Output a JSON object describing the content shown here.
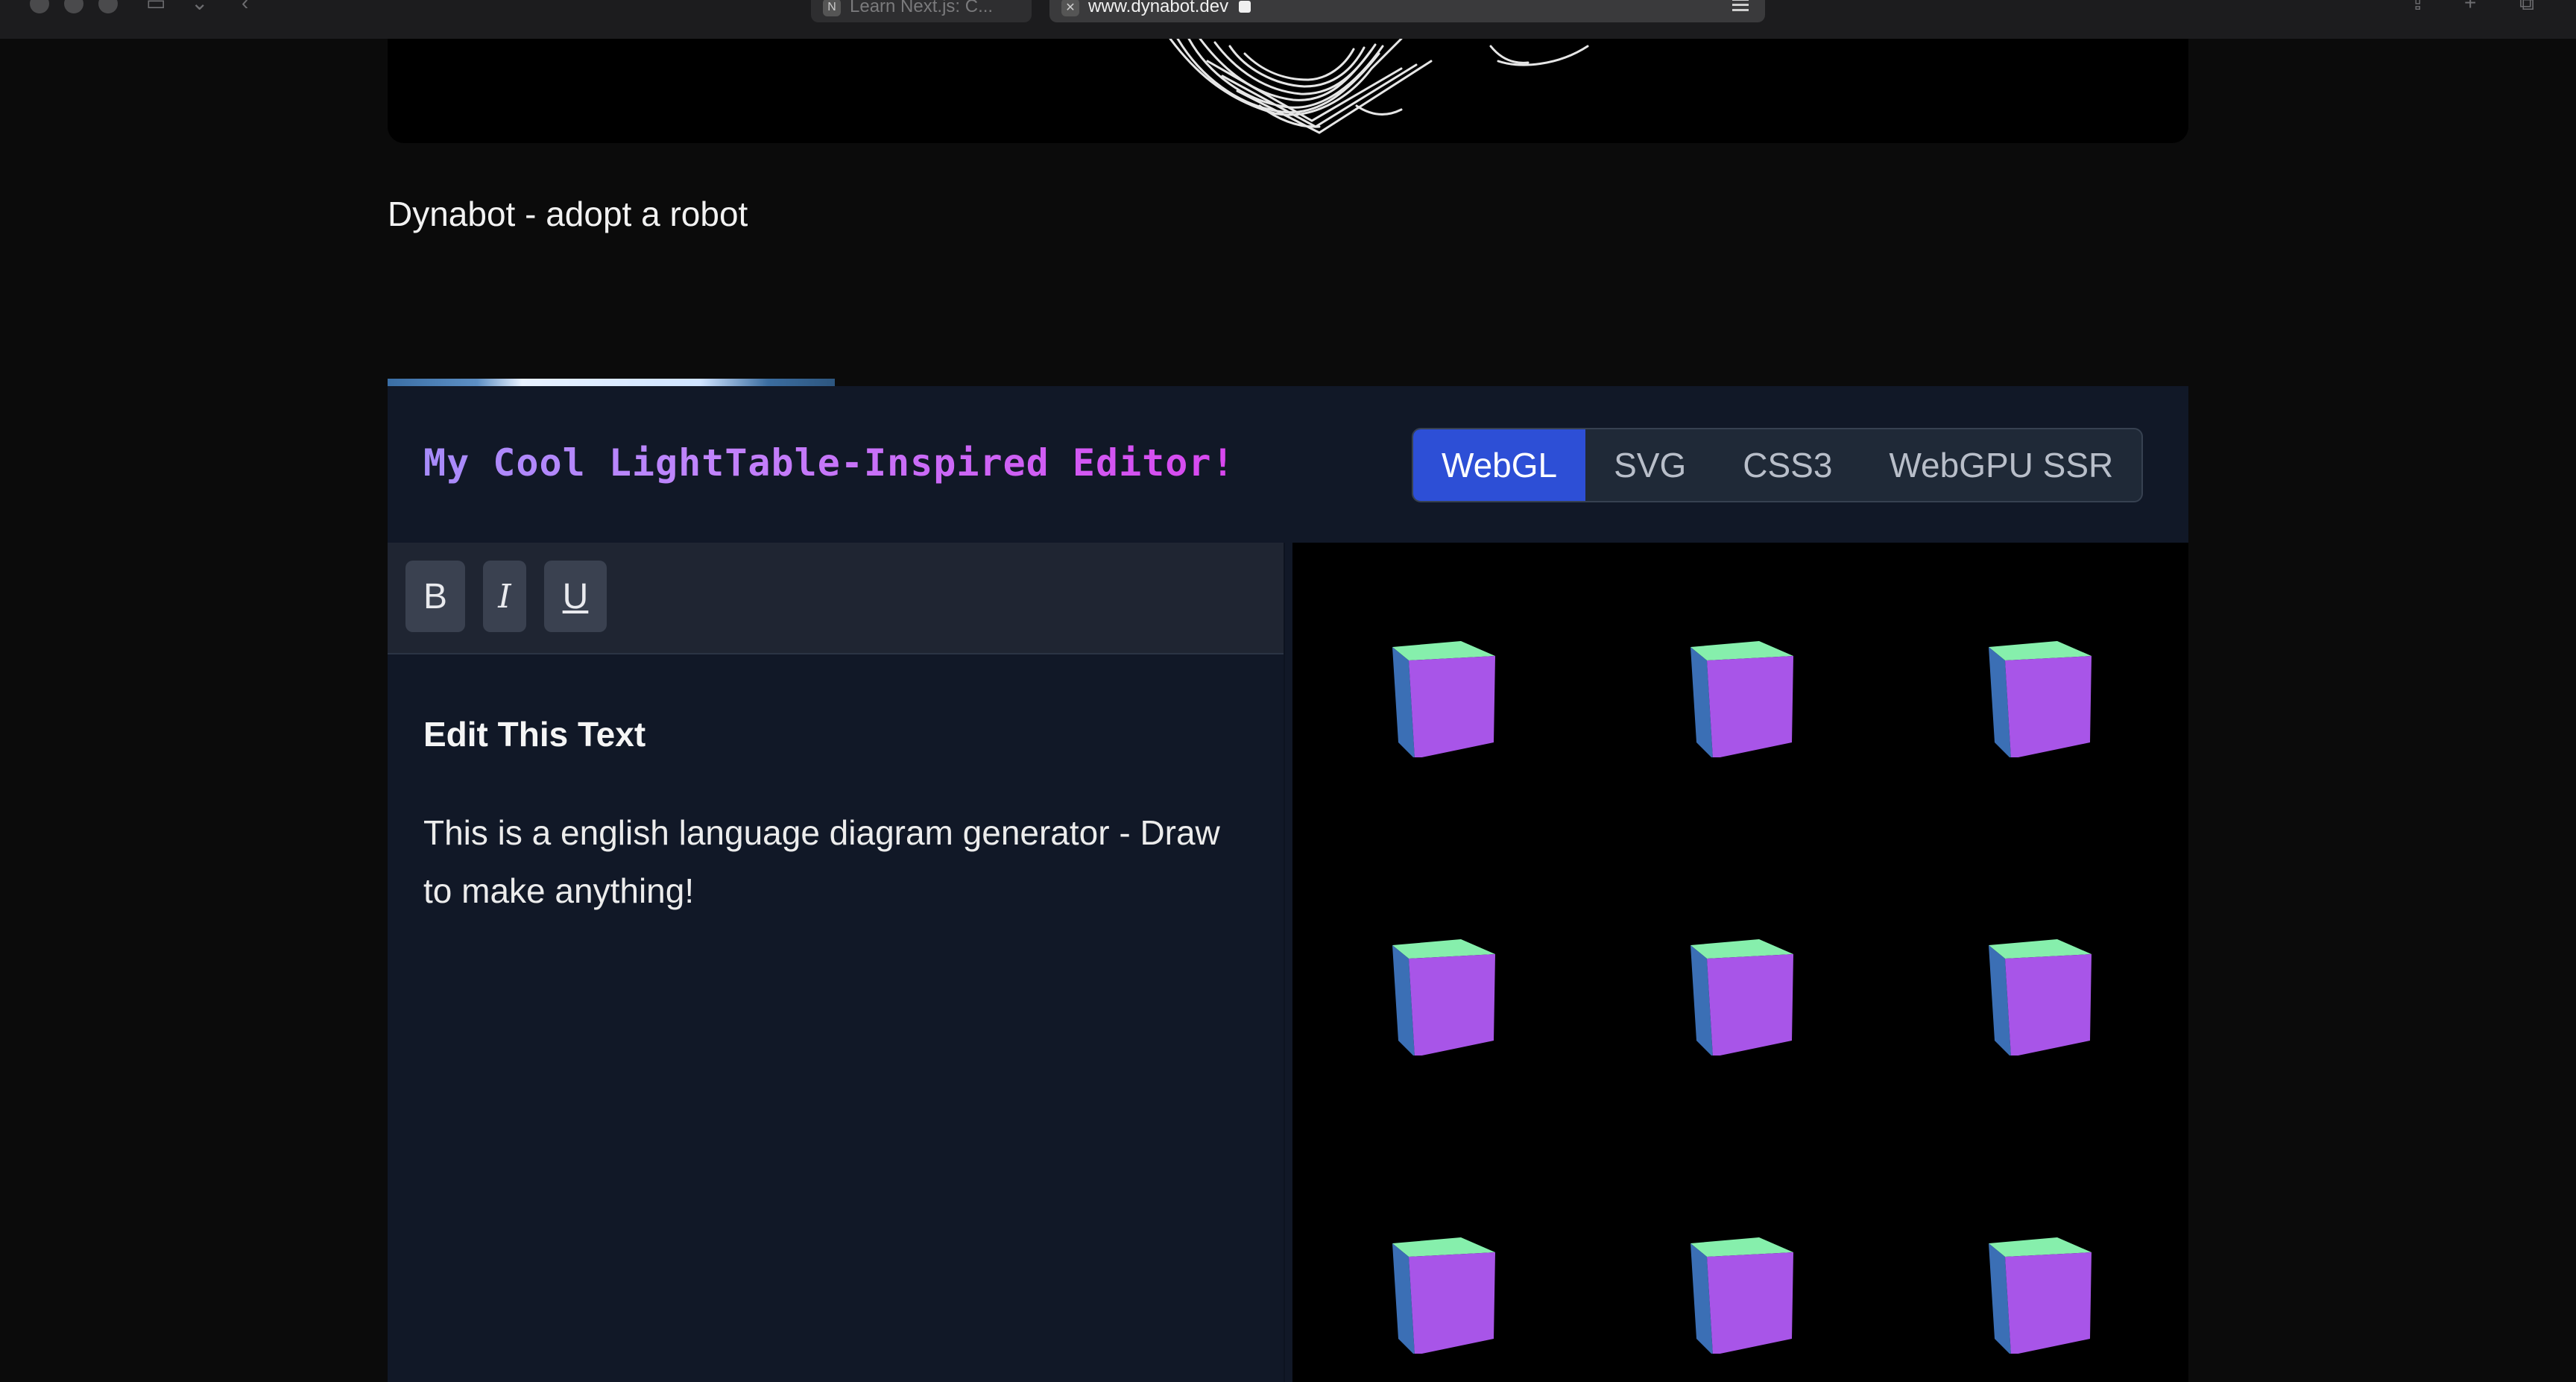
{
  "browser": {
    "tabs": [
      {
        "title": "Learn Next.js: C...",
        "favicon": "next-logo-icon",
        "active": false
      },
      {
        "title": "www.dynabot.dev",
        "favicon": "site-icon",
        "active": true
      }
    ]
  },
  "page": {
    "tagline": "Dynabot - adopt a robot"
  },
  "editor": {
    "title": "My Cool LightTable-Inspired Editor!",
    "modes": [
      "WebGL",
      "SVG",
      "CSS3",
      "WebGPU SSR"
    ],
    "active_mode": "WebGL",
    "toolbar": {
      "bold": "B",
      "italic": "I",
      "underline": "U"
    },
    "document": {
      "heading": "Edit This Text",
      "body": "This is a english language diagram generator - Draw to make anything!"
    },
    "canvas": {
      "cube_rows": 3,
      "cube_cols": 3,
      "colors": {
        "front": "#a855e8",
        "top": "#86efac",
        "side": "#3b6fb5"
      }
    }
  },
  "colors": {
    "accent": "#2d4fd6",
    "background": "#0b0b0b",
    "panel": "#111827"
  }
}
